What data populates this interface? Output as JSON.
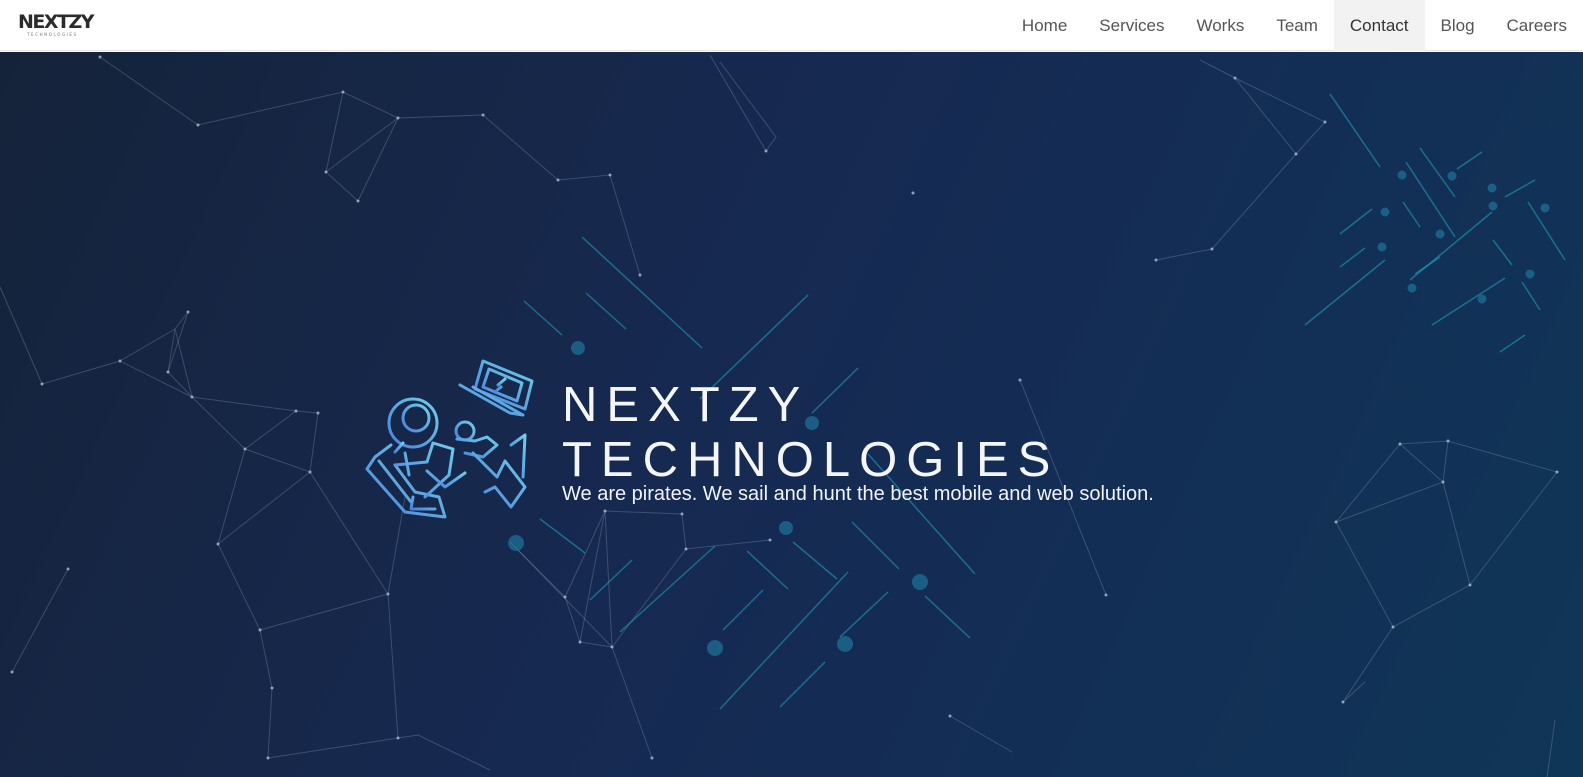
{
  "brand": {
    "logo_text": "NEXTZY",
    "logo_subtext": "TECHNOLOGIES"
  },
  "nav": {
    "items": [
      {
        "label": "Home"
      },
      {
        "label": "Services"
      },
      {
        "label": "Works"
      },
      {
        "label": "Team"
      },
      {
        "label": "Contact",
        "active": true
      },
      {
        "label": "Blog"
      },
      {
        "label": "Careers"
      }
    ]
  },
  "hero": {
    "title_line1": "NEXTZY",
    "title_line2": "TECHNOLOGIES",
    "tagline": "We are pirates. We sail and hunt the best mobile and web solution.",
    "illustration": "astronaut-with-laptop-icon"
  },
  "colors": {
    "hero_bg_dark": "#15233a",
    "hero_bg_mid": "#162951",
    "hero_bg_light": "#0f3656",
    "accent_cyan": "#1fa6c4",
    "illustration_blue": "#5aa9e6",
    "nav_active_bg": "#f2f2f2"
  }
}
